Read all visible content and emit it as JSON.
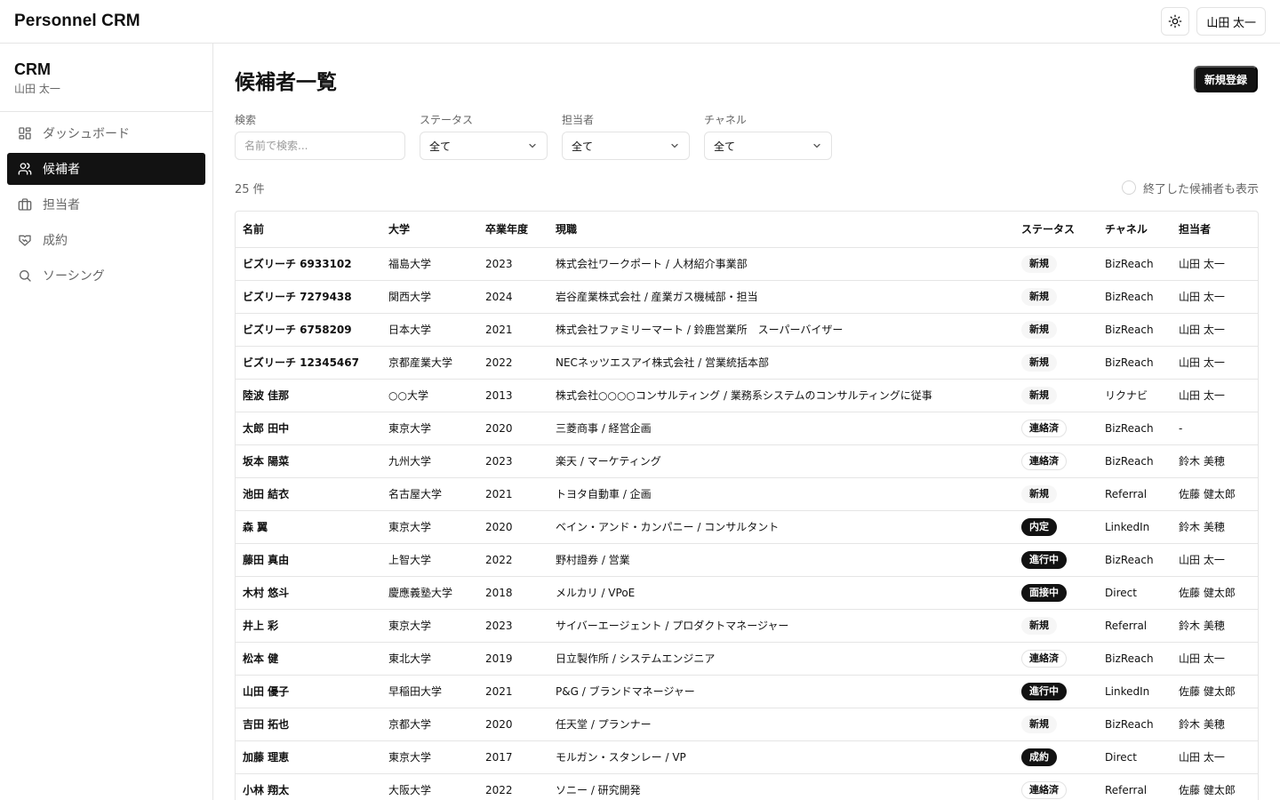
{
  "app": {
    "title": "Personnel CRM",
    "user": "山田 太一",
    "theme_icon": "sun-icon"
  },
  "sidebar": {
    "title": "CRM",
    "subtitle": "山田 太一",
    "items": [
      {
        "label": "ダッシュボード",
        "icon": "dashboard-icon",
        "active": false
      },
      {
        "label": "候補者",
        "icon": "users-icon",
        "active": true
      },
      {
        "label": "担当者",
        "icon": "briefcase-icon",
        "active": false
      },
      {
        "label": "成約",
        "icon": "handshake-icon",
        "active": false
      },
      {
        "label": "ソーシング",
        "icon": "search-icon",
        "active": false
      }
    ]
  },
  "page": {
    "title": "候補者一覧",
    "new_button": "新規登録",
    "filters": {
      "search_label": "検索",
      "search_placeholder": "名前で検索...",
      "status_label": "ステータス",
      "status_value": "全て",
      "owner_label": "担当者",
      "owner_value": "全て",
      "channel_label": "チャネル",
      "channel_value": "全て"
    },
    "count": "25 件",
    "show_closed_label": "終了した候補者も表示"
  },
  "table": {
    "headers": [
      "名前",
      "大学",
      "卒業年度",
      "現職",
      "ステータス",
      "チャネル",
      "担当者"
    ],
    "rows": [
      {
        "name": "ビズリーチ 6933102",
        "university": "福島大学",
        "year": "2023",
        "job": "株式会社ワークポート / 人材紹介事業部",
        "status": "新規",
        "channel": "BizReach",
        "owner": "山田 太一"
      },
      {
        "name": "ビズリーチ 7279438",
        "university": "関西大学",
        "year": "2024",
        "job": "岩谷産業株式会社 / 産業ガス機械部・担当",
        "status": "新規",
        "channel": "BizReach",
        "owner": "山田 太一"
      },
      {
        "name": "ビズリーチ 6758209",
        "university": "日本大学",
        "year": "2021",
        "job": "株式会社ファミリーマート / 鈴鹿営業所　スーパーバイザー",
        "status": "新規",
        "channel": "BizReach",
        "owner": "山田 太一"
      },
      {
        "name": "ビズリーチ 12345467",
        "university": "京都産業大学",
        "year": "2022",
        "job": "NECネッツエスアイ株式会社 / 営業統括本部",
        "status": "新規",
        "channel": "BizReach",
        "owner": "山田 太一"
      },
      {
        "name": "陸波 佳那",
        "university": "○○大学",
        "year": "2013",
        "job": "株式会社○○○○コンサルティング / 業務系システムのコンサルティングに従事",
        "status": "新規",
        "channel": "リクナビ",
        "owner": "山田 太一"
      },
      {
        "name": "太郎 田中",
        "university": "東京大学",
        "year": "2020",
        "job": "三菱商事 / 経営企画",
        "status": "連絡済",
        "channel": "BizReach",
        "owner": "-"
      },
      {
        "name": "坂本 陽菜",
        "university": "九州大学",
        "year": "2023",
        "job": "楽天 / マーケティング",
        "status": "連絡済",
        "channel": "BizReach",
        "owner": "鈴木 美穂"
      },
      {
        "name": "池田 結衣",
        "university": "名古屋大学",
        "year": "2021",
        "job": "トヨタ自動車 / 企画",
        "status": "新規",
        "channel": "Referral",
        "owner": "佐藤 健太郎"
      },
      {
        "name": "森 翼",
        "university": "東京大学",
        "year": "2020",
        "job": "ベイン・アンド・カンパニー / コンサルタント",
        "status": "内定",
        "channel": "LinkedIn",
        "owner": "鈴木 美穂"
      },
      {
        "name": "藤田 真由",
        "university": "上智大学",
        "year": "2022",
        "job": "野村證券 / 営業",
        "status": "進行中",
        "channel": "BizReach",
        "owner": "山田 太一"
      },
      {
        "name": "木村 悠斗",
        "university": "慶應義塾大学",
        "year": "2018",
        "job": "メルカリ / VPoE",
        "status": "面接中",
        "channel": "Direct",
        "owner": "佐藤 健太郎"
      },
      {
        "name": "井上 彩",
        "university": "東京大学",
        "year": "2023",
        "job": "サイバーエージェント / プロダクトマネージャー",
        "status": "新規",
        "channel": "Referral",
        "owner": "鈴木 美穂"
      },
      {
        "name": "松本 健",
        "university": "東北大学",
        "year": "2019",
        "job": "日立製作所 / システムエンジニア",
        "status": "連絡済",
        "channel": "BizReach",
        "owner": "山田 太一"
      },
      {
        "name": "山田 優子",
        "university": "早稲田大学",
        "year": "2021",
        "job": "P&G / ブランドマネージャー",
        "status": "進行中",
        "channel": "LinkedIn",
        "owner": "佐藤 健太郎"
      },
      {
        "name": "吉田 拓也",
        "university": "京都大学",
        "year": "2020",
        "job": "任天堂 / プランナー",
        "status": "新規",
        "channel": "BizReach",
        "owner": "鈴木 美穂"
      },
      {
        "name": "加藤 理恵",
        "university": "東京大学",
        "year": "2017",
        "job": "モルガン・スタンレー / VP",
        "status": "成約",
        "channel": "Direct",
        "owner": "山田 太一"
      },
      {
        "name": "小林 翔太",
        "university": "大阪大学",
        "year": "2022",
        "job": "ソニー / 研究開発",
        "status": "連絡済",
        "channel": "Referral",
        "owner": "佐藤 健太郎"
      }
    ]
  }
}
